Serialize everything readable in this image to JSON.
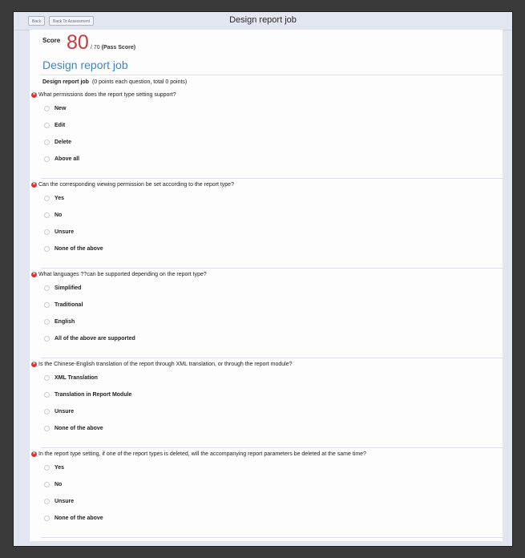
{
  "window": {
    "title": "Design report job",
    "back_label": "Back",
    "back_assessment_label": "Back To Assessment"
  },
  "score": {
    "label": "Score",
    "value": "80",
    "total": "/ 70",
    "pass_label": "(Pass Score)"
  },
  "job_title": "Design report job",
  "section": {
    "title": "Design report job",
    "points_note": "(0 points each question, total 0 points)"
  },
  "questions": [
    {
      "text": "What permissions does the report type setting support?",
      "options": [
        "New",
        "Edit",
        "Delete",
        "Above all"
      ]
    },
    {
      "text": "Can the corresponding viewing permission be set according to the report type?",
      "options": [
        "Yes",
        "No",
        "Unsure",
        "None of the above"
      ]
    },
    {
      "text": "What languages ??can be supported depending on the report type?",
      "options": [
        "Simplified",
        "Traditional",
        "English",
        "All of the above are supported"
      ]
    },
    {
      "text": "Is the Chinese-English translation of the report through XML translation, or through the report module?",
      "options": [
        "XML Translation",
        "Translation in Report Module",
        "Unsure",
        "None of the above"
      ]
    },
    {
      "text": "In the report type setting, if one of the report types is deleted, will the accompanying report parameters be deleted at the same time?",
      "options": [
        "Yes",
        "No",
        "Unsure",
        "None of the above"
      ]
    }
  ],
  "colors": {
    "score": "#c83a3f",
    "heading": "#3c86bd",
    "wrong_icon": "#d6333c"
  }
}
